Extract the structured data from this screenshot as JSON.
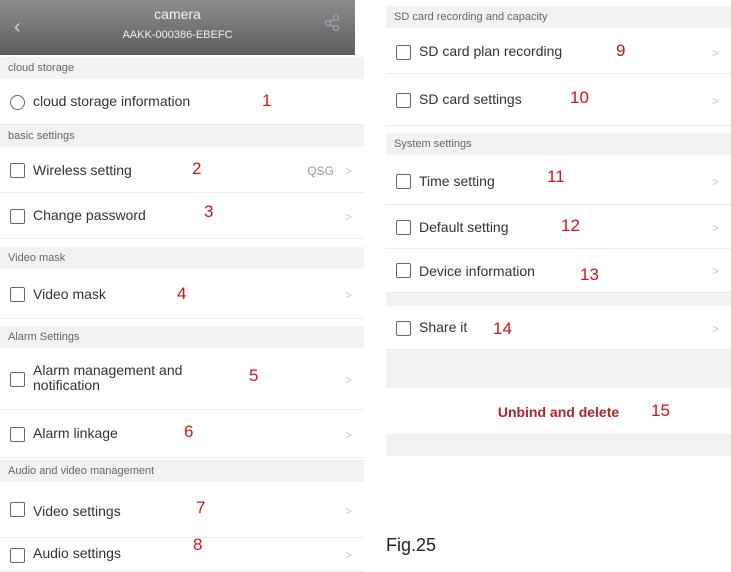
{
  "header": {
    "title": "camera",
    "device_id": "AAKK-000386-EBEFC"
  },
  "sections": {
    "cloud": "cloud storage",
    "basic": "basic settings",
    "mask": "Video mask",
    "alarm": "Alarm Settings",
    "av": "Audio and video management",
    "sd": "SD card recording and capacity",
    "system": "System settings"
  },
  "items": {
    "cloud_info": "cloud storage information",
    "wireless": "Wireless setting",
    "wireless_value": "QSG",
    "password": "Change password",
    "video_mask": "Video mask",
    "alarm_mgmt": "Alarm management and notification",
    "alarm_link": "Alarm linkage",
    "video_settings": "Video settings",
    "audio_settings": "Audio settings",
    "sd_plan": "SD card plan recording",
    "sd_settings": "SD card settings",
    "time": "Time setting",
    "default": "Default setting",
    "device_info": "Device information",
    "share": "Share it",
    "unbind": "Unbind and delete"
  },
  "chevron": ">",
  "callouts": [
    "1",
    "2",
    "3",
    "4",
    "5",
    "6",
    "7",
    "8",
    "9",
    "10",
    "11",
    "12",
    "13",
    "14",
    "15"
  ],
  "caption": "Fig.25"
}
